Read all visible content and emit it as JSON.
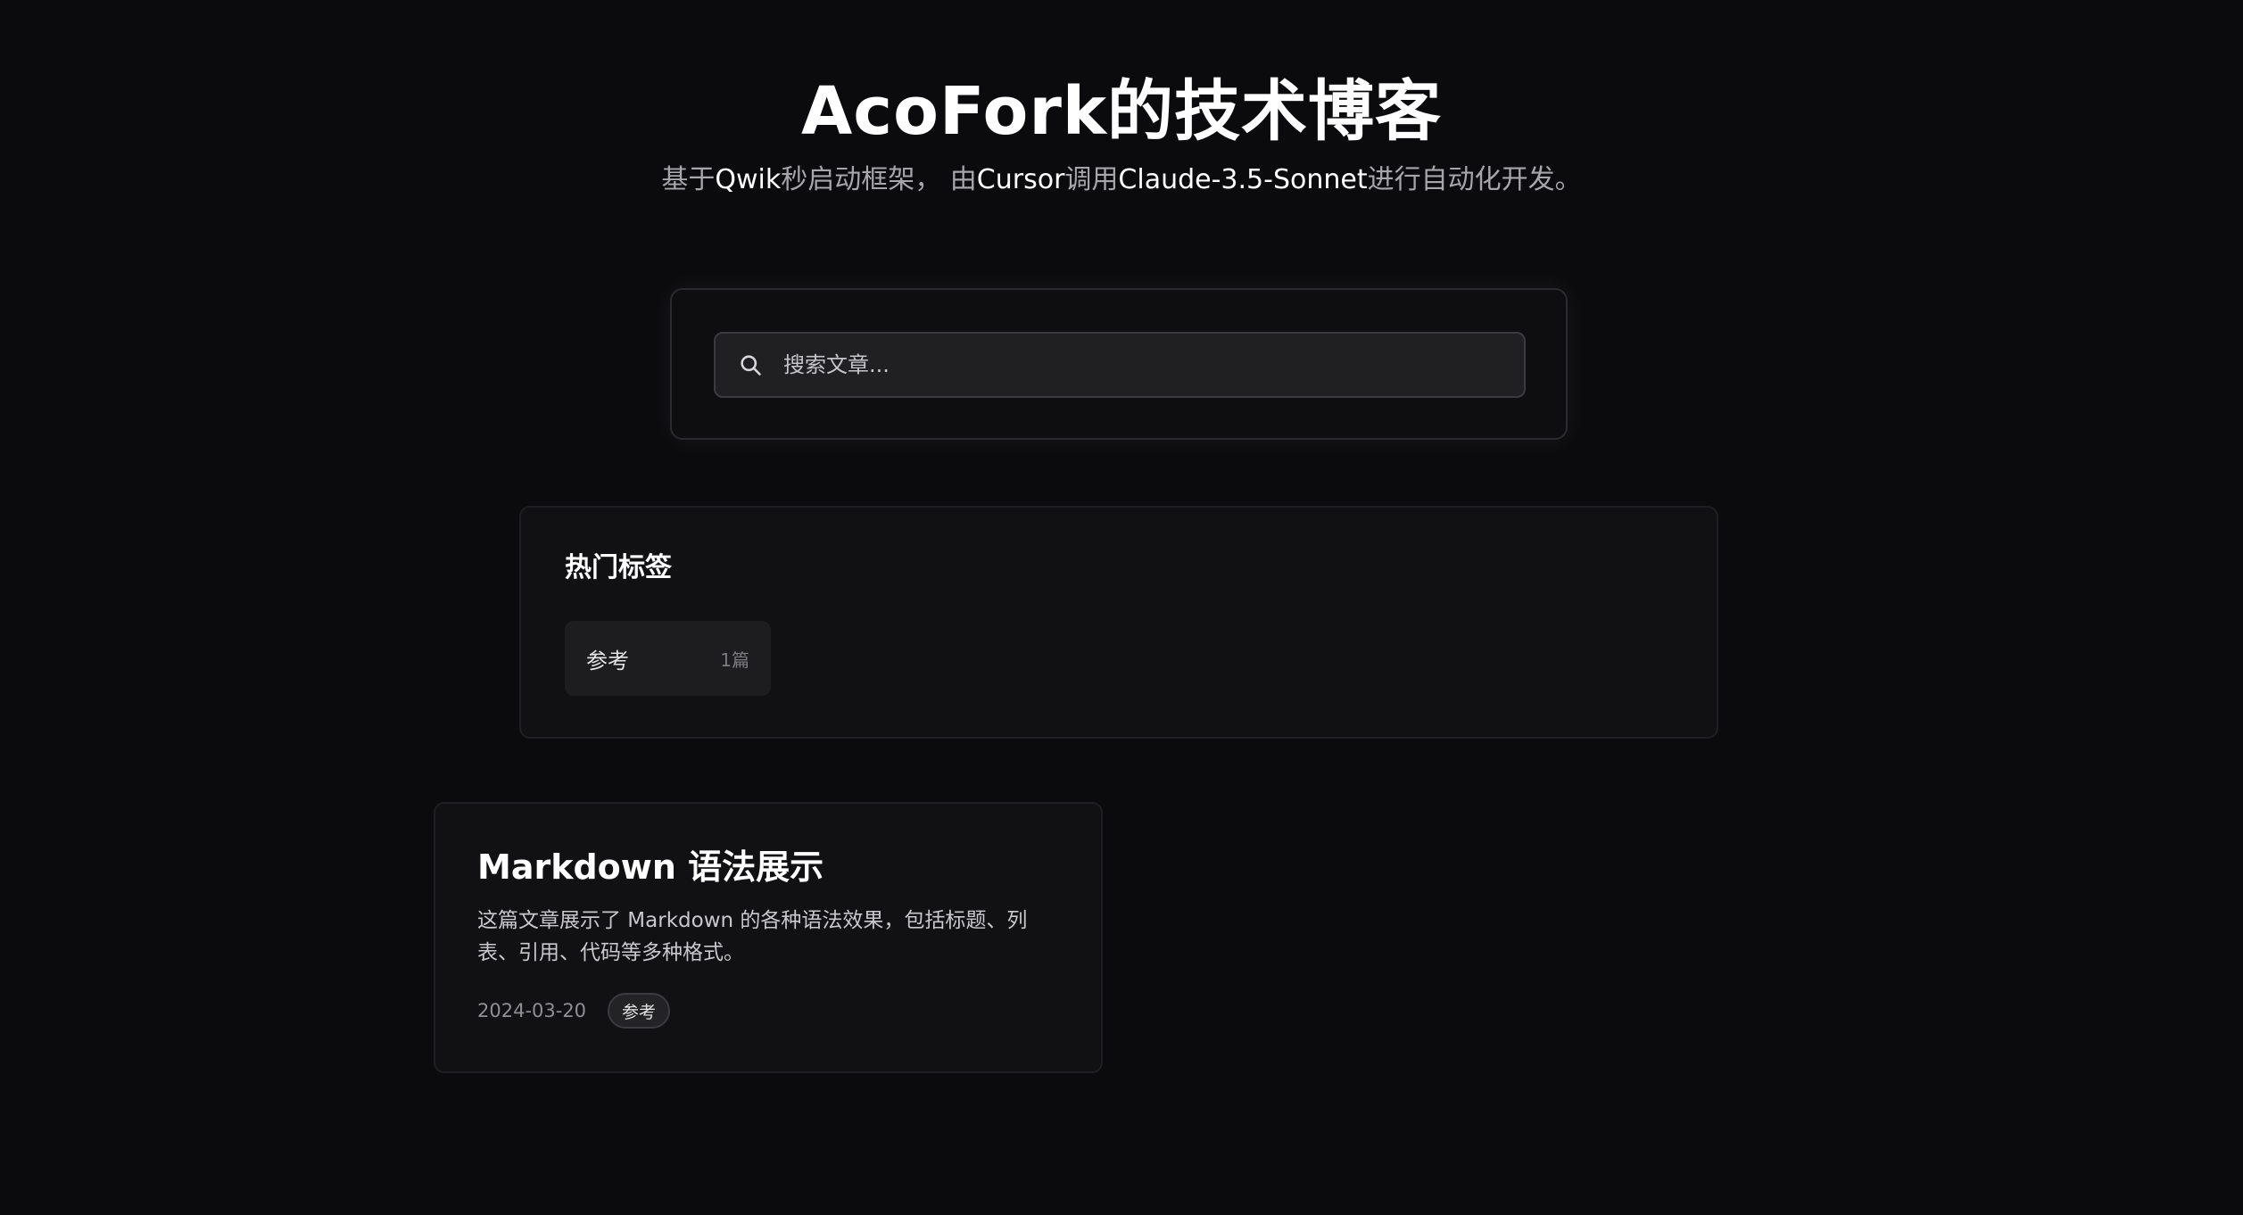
{
  "header": {
    "title": "AcoFork的技术博客",
    "subtitle": {
      "p1": "基于",
      "p2": "Qwik",
      "p3": "秒启动框架， 由",
      "p4": "Cursor",
      "p5": "调用",
      "p6": "Claude-3.5-Sonnet",
      "p7": "进行自动化开发。"
    }
  },
  "search": {
    "placeholder": "搜索文章...",
    "icon": "search-icon"
  },
  "tags": {
    "title": "热门标签",
    "items": [
      {
        "name": "参考",
        "count": "1篇"
      }
    ]
  },
  "posts": [
    {
      "title": "Markdown 语法展示",
      "description": "这篇文章展示了 Markdown 的各种语法效果，包括标题、列表、引用、代码等多种格式。",
      "date": "2024-03-20",
      "tag": "参考"
    }
  ],
  "colors": {
    "background": "#0b0b0d",
    "card": "#111113",
    "text": "#ffffff",
    "muted": "#a6a6ab"
  }
}
